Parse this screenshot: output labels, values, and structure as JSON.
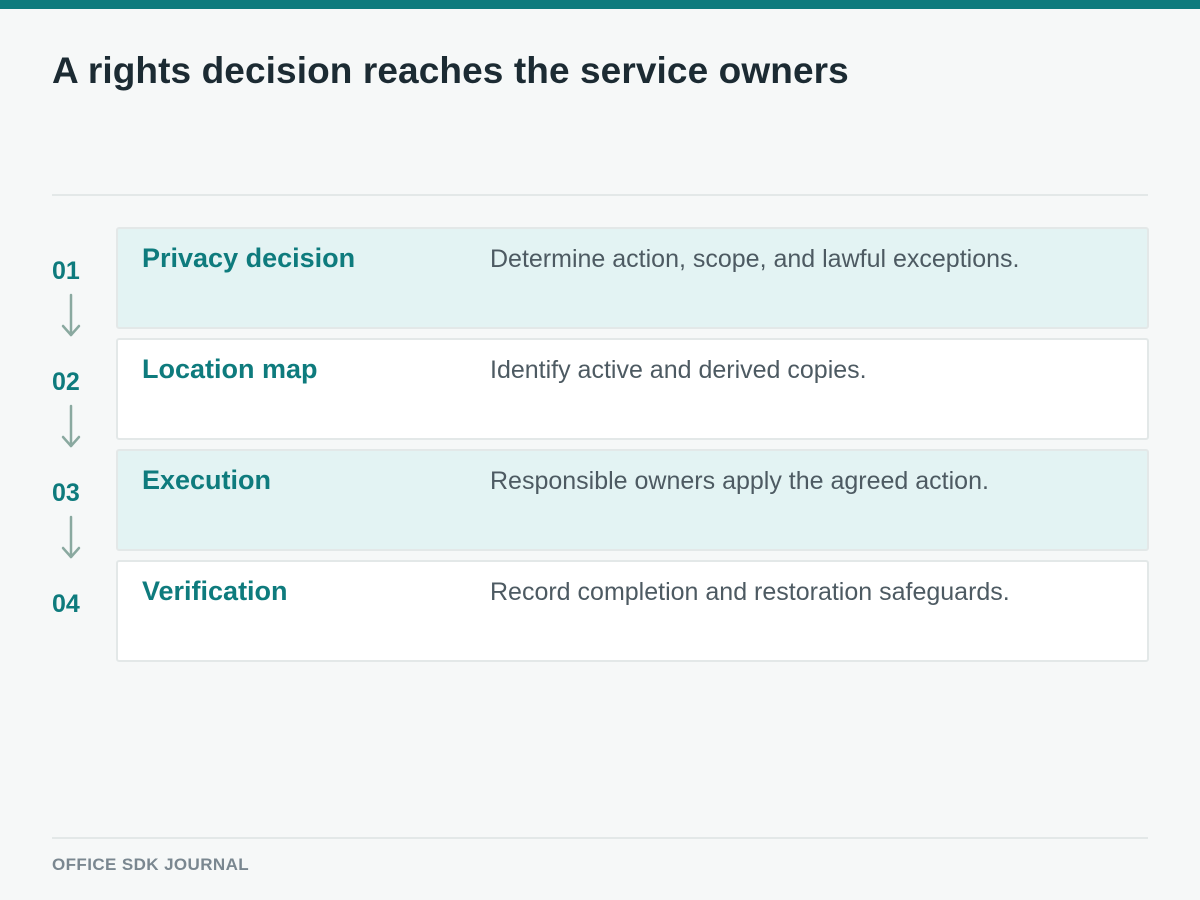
{
  "title": "A rights decision reaches the service owners",
  "footer": "OFFICE SDK JOURNAL",
  "colors": {
    "accent": "#0e7b7d",
    "shaded_card": "#e3f3f3",
    "card": "#ffffff",
    "arrow": "#8aa9a0"
  },
  "steps": [
    {
      "number": "01",
      "label": "Privacy decision",
      "description": "Determine action, scope, and lawful exceptions.",
      "shaded": true,
      "arrow_icon": "arrow-down-icon"
    },
    {
      "number": "02",
      "label": "Location map",
      "description": "Identify active and derived copies.",
      "shaded": false,
      "arrow_icon": "arrow-down-icon"
    },
    {
      "number": "03",
      "label": "Execution",
      "description": "Responsible owners apply the agreed action.",
      "shaded": true,
      "arrow_icon": "arrow-down-icon"
    },
    {
      "number": "04",
      "label": "Verification",
      "description": "Record completion and restoration safeguards.",
      "shaded": false,
      "arrow_icon": null
    }
  ]
}
